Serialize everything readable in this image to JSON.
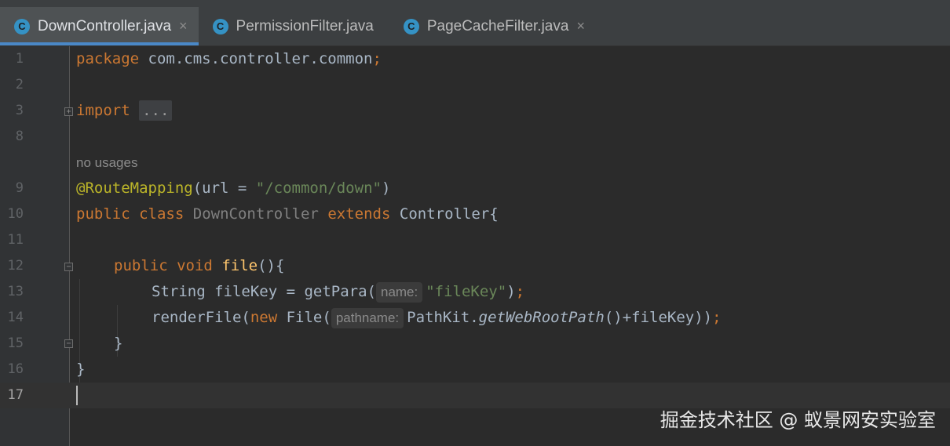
{
  "tabs": [
    {
      "label": "DownController.java",
      "icon": "C",
      "active": true,
      "close": "×"
    },
    {
      "label": "PermissionFilter.java",
      "icon": "C",
      "active": false
    },
    {
      "label": "PageCacheFilter.java",
      "icon": "C",
      "active": false,
      "close": "×"
    }
  ],
  "gutter": {
    "line_numbers": [
      "1",
      "2",
      "3",
      "8",
      "9",
      "10",
      "11",
      "12",
      "13",
      "14",
      "15",
      "16",
      "17"
    ],
    "current_line": "17"
  },
  "code": {
    "l1": {
      "kw": "package",
      "rest": " com.cms.controller.common",
      "semi": ";"
    },
    "l3": {
      "kw": "import",
      "dots": "..."
    },
    "usages": "no usages",
    "l9": {
      "ann": "@RouteMapping",
      "open": "(url = ",
      "str": "\"/common/down\"",
      "close": ")"
    },
    "l10": {
      "kw1": "public",
      "kw2": "class",
      "cls": "DownController",
      "kw3": "extends",
      "base": "Controller{"
    },
    "l12": {
      "kw1": "public",
      "kw2": "void",
      "mth": "file",
      "rest": "(){"
    },
    "l13": {
      "pre": "String fileKey = getPara(",
      "hint": "name:",
      "str": "\"fileKey\"",
      "post": ")",
      "semi": ";"
    },
    "l14": {
      "pre": "renderFile(",
      "kw": "new",
      "mid": " File(",
      "hint": "pathname:",
      "cls": "PathKit.",
      "mth": "getWebRootPath",
      "post": "()+fileKey))",
      "semi": ";"
    },
    "l15": "}",
    "l16": "}"
  },
  "watermark": "掘金技术社区 @ 蚁景网安实验室",
  "colors": {
    "background": "#2b2b2b",
    "keyword": "#cc7832",
    "string": "#6a8759",
    "annotation": "#bbb529",
    "method": "#ffc66d",
    "text": "#a9b7c6",
    "tab_accent": "#4a88c7",
    "class_icon": "#3592c4"
  }
}
